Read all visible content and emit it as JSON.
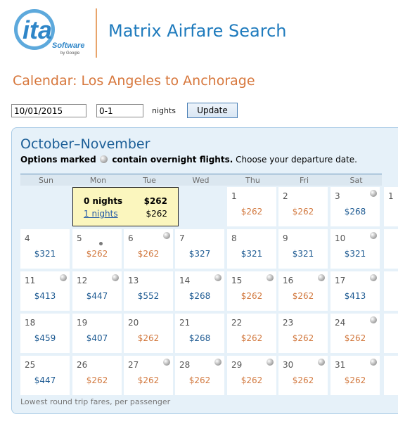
{
  "logo": {
    "main": "ita",
    "sub": "Software",
    "by": "by Google"
  },
  "header": {
    "title": "Matrix Airfare Search"
  },
  "calendar": {
    "title": "Calendar: Los Angeles to Anchorage"
  },
  "form": {
    "date_value": "10/01/2015",
    "nights_value": "0-1",
    "nights_label": "nights",
    "update_label": "Update"
  },
  "month": {
    "title": "October–November"
  },
  "note": {
    "part1": "Options marked",
    "part2": "contain overnight flights.",
    "part3": " Choose your departure date."
  },
  "dow": [
    "Sun",
    "Mon",
    "Tue",
    "Wed",
    "Thu",
    "Fri",
    "Sat"
  ],
  "popup": {
    "row1_left": "0 nights",
    "row1_right": "$262",
    "row2_left": "1 nights",
    "row2_right": "$262"
  },
  "days": [
    {
      "num": "1",
      "price": "$262",
      "color": "orange",
      "overnight": false
    },
    {
      "num": "2",
      "price": "$262",
      "color": "orange",
      "overnight": false
    },
    {
      "num": "3",
      "price": "$268",
      "color": "blue",
      "overnight": true
    },
    {
      "num": "4",
      "price": "$321",
      "color": "blue",
      "overnight": false
    },
    {
      "num": "5",
      "price": "$262",
      "color": "orange",
      "overnight": false,
      "small_dot": true
    },
    {
      "num": "6",
      "price": "$262",
      "color": "orange",
      "overnight": true
    },
    {
      "num": "7",
      "price": "$327",
      "color": "blue",
      "overnight": false
    },
    {
      "num": "8",
      "price": "$321",
      "color": "blue",
      "overnight": false
    },
    {
      "num": "9",
      "price": "$321",
      "color": "blue",
      "overnight": false
    },
    {
      "num": "10",
      "price": "$321",
      "color": "blue",
      "overnight": true
    },
    {
      "num": "11",
      "price": "$413",
      "color": "blue",
      "overnight": true
    },
    {
      "num": "12",
      "price": "$447",
      "color": "blue",
      "overnight": true
    },
    {
      "num": "13",
      "price": "$552",
      "color": "blue",
      "overnight": false
    },
    {
      "num": "14",
      "price": "$268",
      "color": "blue",
      "overnight": true
    },
    {
      "num": "15",
      "price": "$262",
      "color": "orange",
      "overnight": true
    },
    {
      "num": "16",
      "price": "$262",
      "color": "orange",
      "overnight": true
    },
    {
      "num": "17",
      "price": "$413",
      "color": "blue",
      "overnight": true
    },
    {
      "num": "18",
      "price": "$459",
      "color": "blue",
      "overnight": false
    },
    {
      "num": "19",
      "price": "$407",
      "color": "blue",
      "overnight": false
    },
    {
      "num": "20",
      "price": "$262",
      "color": "orange",
      "overnight": false
    },
    {
      "num": "21",
      "price": "$268",
      "color": "blue",
      "overnight": false
    },
    {
      "num": "22",
      "price": "$262",
      "color": "orange",
      "overnight": false
    },
    {
      "num": "23",
      "price": "$262",
      "color": "orange",
      "overnight": false
    },
    {
      "num": "24",
      "price": "$262",
      "color": "orange",
      "overnight": true
    },
    {
      "num": "25",
      "price": "$447",
      "color": "blue",
      "overnight": false
    },
    {
      "num": "26",
      "price": "$262",
      "color": "orange",
      "overnight": false
    },
    {
      "num": "27",
      "price": "$262",
      "color": "orange",
      "overnight": true
    },
    {
      "num": "28",
      "price": "$262",
      "color": "orange",
      "overnight": true
    },
    {
      "num": "29",
      "price": "$262",
      "color": "orange",
      "overnight": true
    },
    {
      "num": "30",
      "price": "$262",
      "color": "orange",
      "overnight": true
    },
    {
      "num": "31",
      "price": "$262",
      "color": "orange",
      "overnight": true
    }
  ],
  "next_month_partial": [
    {
      "num": "1"
    }
  ],
  "footer": {
    "text": "Lowest round trip fares, per passenger"
  },
  "colors": {
    "accent_blue": "#1f7bbd",
    "title_orange": "#d7773c",
    "price_orange": "#d2793f",
    "price_blue": "#1d5a92",
    "popup_bg": "#fbf6be"
  }
}
